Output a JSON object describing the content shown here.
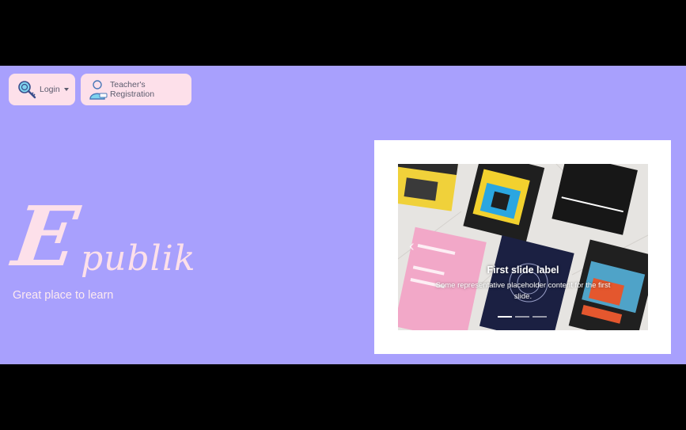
{
  "nav": {
    "login_label": "Login",
    "registration_label": "Teacher's Registration"
  },
  "brand": {
    "logo_text": "Epublik",
    "tagline": "Great place to learn"
  },
  "carousel": {
    "slide_title": "First slide label",
    "slide_text": "Some representative placeholder content for the first slide.",
    "indicator_count": 3,
    "active_index": 0
  },
  "colors": {
    "background": "#a8a0fd",
    "button_bg": "#fde0ea",
    "logo": "#fde0ea"
  }
}
